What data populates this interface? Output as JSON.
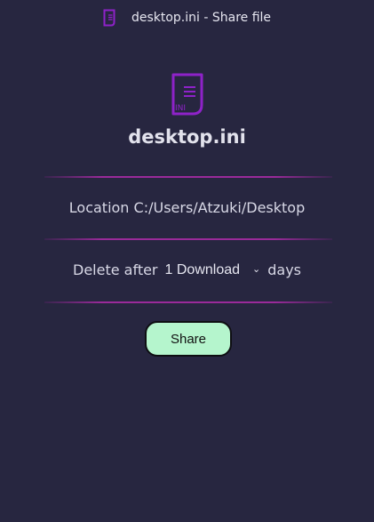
{
  "window": {
    "title": "desktop.ini - Share file"
  },
  "file": {
    "name": "desktop.ini",
    "icon": "ini-file-icon",
    "icon_badge": "INI"
  },
  "location": {
    "text": "Location C:/Users/Atzuki/Desktop"
  },
  "delete_after": {
    "label": "Delete after",
    "selected": "1 Download",
    "unit": "days"
  },
  "actions": {
    "share_label": "Share"
  },
  "colors": {
    "background": "#272640",
    "accent": "#9a2a9a",
    "icon_purple": "#8e22c8",
    "share_button": "#b5f5cd"
  }
}
